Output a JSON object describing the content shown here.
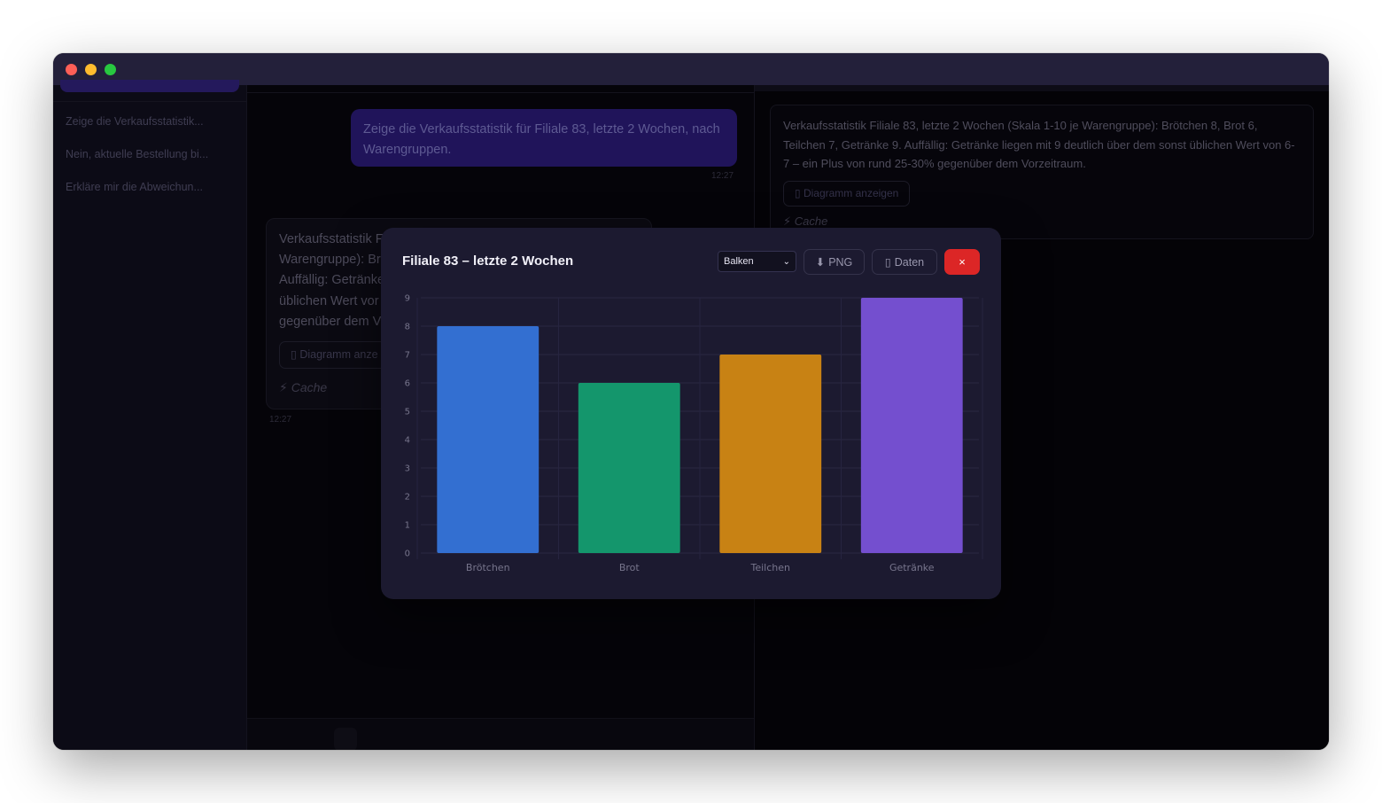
{
  "sidebar": {
    "conversations": [
      "Zeige die Verkaufsstatistik...",
      "Nein, aktuelle Bestellung bi...",
      "Erkläre mir die Abweichun..."
    ]
  },
  "chat": {
    "user_message": "Zeige die Verkaufsstatistik für Filiale 83, letzte 2 Wochen, nach Warengruppen.",
    "user_time": "12:27",
    "bot_lines": [
      "Verkaufsstatistik F",
      "Warengruppe): Br",
      "Auffällig: Getränke",
      "üblichen Wert vor",
      "gegenüber dem V"
    ],
    "bot_button": "▯ Diagramm anze",
    "bot_cache": "⚡ Cache",
    "bot_time": "12:27"
  },
  "right_panel": {
    "text": "Verkaufsstatistik Filiale 83, letzte 2 Wochen (Skala 1-10 je Warengruppe): Brötchen 8, Brot 6, Teilchen 7, Getränke 9. Auffällig: Getränke liegen mit 9 deutlich über dem sonst üblichen Wert von 6-7 – ein Plus von rund 25-30% gegenüber dem Vorzeitraum.",
    "button": "▯ Diagramm anzeigen",
    "cache": "⚡ Cache"
  },
  "modal": {
    "title": "Filiale 83 – letzte 2 Wochen",
    "chart_type_selected": "Balken",
    "png_icon": "⬇",
    "png_label": "PNG",
    "data_icon": "▯",
    "data_label": "Daten",
    "close_label": "×"
  },
  "chart_data": {
    "type": "bar",
    "categories": [
      "Brötchen",
      "Brot",
      "Teilchen",
      "Getränke"
    ],
    "values": [
      8,
      6,
      7,
      9
    ],
    "colors": [
      "#336fd1",
      "#14966c",
      "#c88214",
      "#744fcf"
    ],
    "ylim": [
      0,
      9
    ],
    "yticks": [
      0,
      1,
      2,
      3,
      4,
      5,
      6,
      7,
      8,
      9
    ],
    "grid": true,
    "title": "",
    "xlabel": "",
    "ylabel": ""
  }
}
